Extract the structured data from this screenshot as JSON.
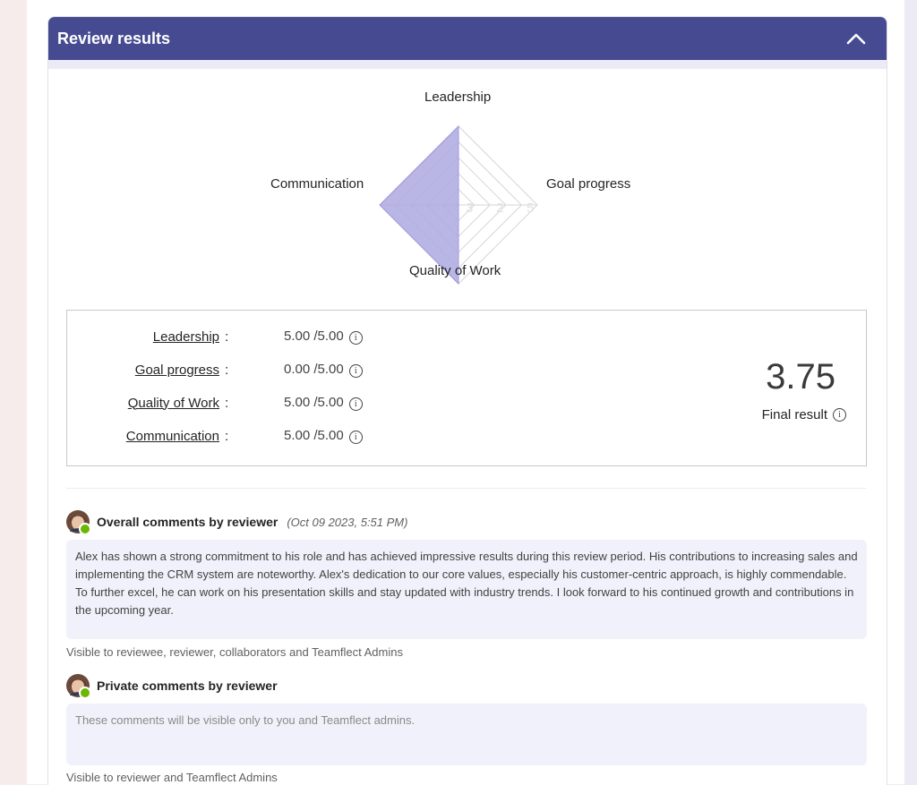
{
  "panel": {
    "title": "Review results",
    "collapse_icon": "chevron-up-icon",
    "header_color": "#464b91"
  },
  "chart_data": {
    "type": "radar",
    "axes": [
      "Leadership",
      "Goal progress",
      "Quality of Work",
      "Communication"
    ],
    "values": [
      5,
      0,
      5,
      5
    ],
    "max": 5,
    "ticks": [
      1,
      2,
      3,
      4,
      5
    ],
    "tick_labels_visible": [
      "3",
      "2",
      "5"
    ],
    "fill_color": "#ada9e2"
  },
  "scores": {
    "items": [
      {
        "name": "Leadership",
        "value": "5.00 /5.00"
      },
      {
        "name": "Goal progress",
        "value": "0.00 /5.00"
      },
      {
        "name": "Quality of Work",
        "value": "5.00 /5.00"
      },
      {
        "name": "Communication",
        "value": "5.00 /5.00"
      }
    ],
    "separator": ":",
    "final_value": "3.75",
    "final_label": "Final result",
    "info_icon": "info-icon"
  },
  "overall_comment": {
    "title": "Overall comments by reviewer",
    "timestamp": "(Oct 09 2023, 5:51 PM)",
    "text": "Alex has shown a strong commitment to his role and has achieved impressive results during this review period. His contributions to increasing sales and implementing the CRM system are noteworthy. Alex's dedication to our core values, especially his customer-centric approach, is highly commendable. To further excel, he can work on his presentation skills and stay updated with industry trends. I look forward to his continued growth and contributions in the upcoming year.",
    "visibility": "Visible to reviewee, reviewer, collaborators and Teamflect Admins"
  },
  "private_comment": {
    "title": "Private comments by reviewer",
    "placeholder": "These comments will be visible only to you and Teamflect admins.",
    "visibility": "Visible to reviewer and Teamflect Admins"
  },
  "presence_color": "#6bb700"
}
